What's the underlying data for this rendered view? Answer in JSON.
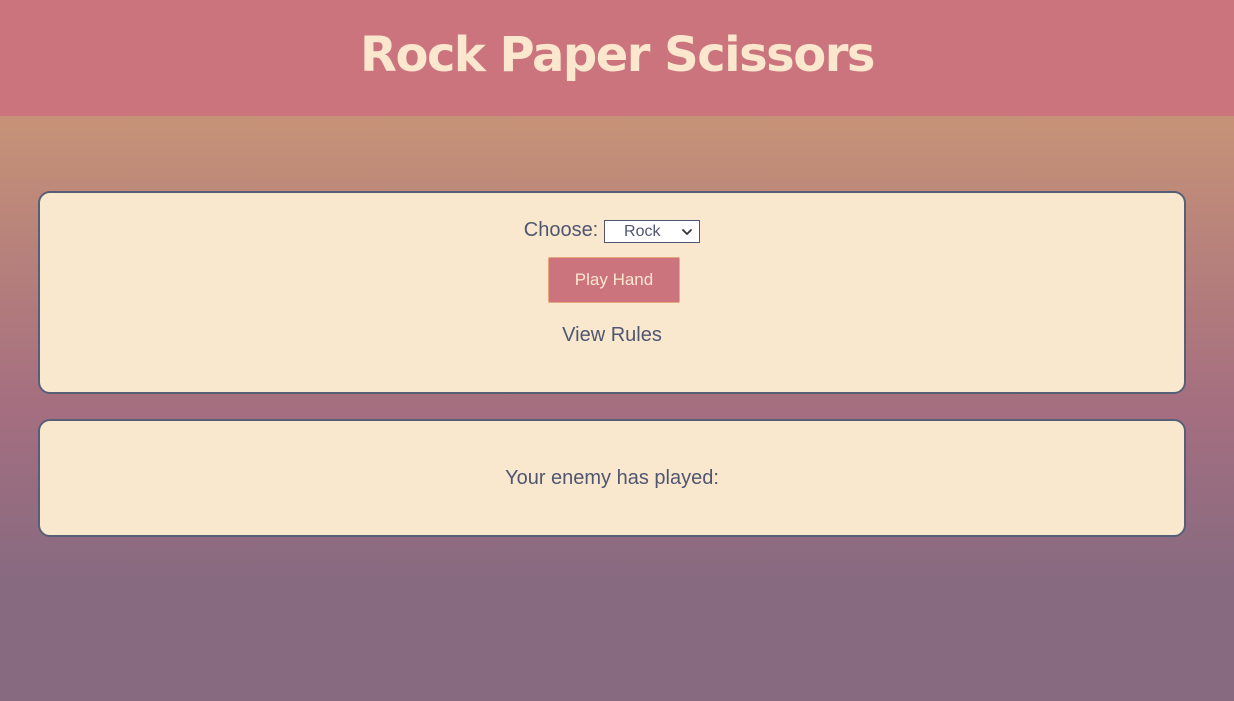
{
  "header": {
    "title": "Rock Paper Scissors"
  },
  "controls": {
    "choose_label": "Choose:",
    "select": {
      "selected": "Rock"
    },
    "play_button_label": "Play Hand",
    "rules_link_label": "View Rules"
  },
  "result": {
    "enemy_text": "Your enemy has played:"
  },
  "icons": {
    "select_arrow": "chevron-down-icon"
  },
  "colors": {
    "header_bg": "#cb747d",
    "title_text": "#fbe6ce",
    "card_bg": "#fae8ce",
    "card_border": "#575f77",
    "body_text": "#4f5672",
    "button_bg": "#cb747d",
    "gradient_top": "#e2ab7b",
    "gradient_bottom": "#876a80"
  }
}
